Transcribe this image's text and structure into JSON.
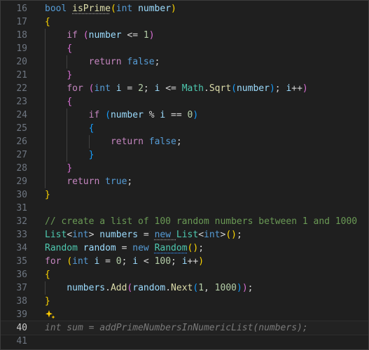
{
  "editor": {
    "theme": {
      "background": "#1f1f1f",
      "keyword": "#569cd6",
      "control": "#c586c0",
      "type": "#4ec9b0",
      "function": "#dcdcaa",
      "variable": "#9cdcfe",
      "number": "#b5cea8",
      "comment": "#6a9955",
      "sparkle": "#ffcc00"
    },
    "active_line": 40,
    "lines": [
      {
        "num": "16",
        "indent": 0,
        "tokens": [
          [
            "bool ",
            "keyword"
          ],
          [
            "isPrime",
            "func",
            "sq-dot"
          ],
          [
            "(",
            "b1"
          ],
          [
            "int ",
            "keyword"
          ],
          [
            "number",
            "var"
          ],
          [
            ")",
            "b1"
          ]
        ]
      },
      {
        "num": "17",
        "indent": 0,
        "tokens": [
          [
            "{",
            "b1"
          ]
        ]
      },
      {
        "num": "18",
        "indent": 1,
        "tokens": [
          [
            "if ",
            "control"
          ],
          [
            "(",
            "b2"
          ],
          [
            "number ",
            "var"
          ],
          [
            "<= ",
            "plain"
          ],
          [
            "1",
            "num"
          ],
          [
            ")",
            "b2"
          ]
        ]
      },
      {
        "num": "19",
        "indent": 1,
        "tokens": [
          [
            "{",
            "b2"
          ]
        ]
      },
      {
        "num": "20",
        "indent": 2,
        "tokens": [
          [
            "return ",
            "control"
          ],
          [
            "false",
            "keyword"
          ],
          [
            ";",
            "plain"
          ]
        ]
      },
      {
        "num": "21",
        "indent": 1,
        "tokens": [
          [
            "}",
            "b2"
          ]
        ]
      },
      {
        "num": "22",
        "indent": 1,
        "tokens": [
          [
            "for ",
            "control"
          ],
          [
            "(",
            "b2"
          ],
          [
            "int ",
            "keyword"
          ],
          [
            "i ",
            "var"
          ],
          [
            "= ",
            "plain"
          ],
          [
            "2",
            "num"
          ],
          [
            "; ",
            "plain"
          ],
          [
            "i ",
            "var"
          ],
          [
            "<= ",
            "plain"
          ],
          [
            "Math",
            "type"
          ],
          [
            ".",
            "plain"
          ],
          [
            "Sqrt",
            "func"
          ],
          [
            "(",
            "b3"
          ],
          [
            "number",
            "var"
          ],
          [
            ")",
            "b3"
          ],
          [
            "; ",
            "plain"
          ],
          [
            "i",
            "var"
          ],
          [
            "++",
            "plain"
          ],
          [
            ")",
            "b2"
          ]
        ]
      },
      {
        "num": "23",
        "indent": 1,
        "tokens": [
          [
            "{",
            "b2"
          ]
        ]
      },
      {
        "num": "24",
        "indent": 2,
        "tokens": [
          [
            "if ",
            "control"
          ],
          [
            "(",
            "b3"
          ],
          [
            "number ",
            "var"
          ],
          [
            "% ",
            "plain"
          ],
          [
            "i ",
            "var"
          ],
          [
            "== ",
            "plain"
          ],
          [
            "0",
            "num"
          ],
          [
            ")",
            "b3"
          ]
        ]
      },
      {
        "num": "25",
        "indent": 2,
        "tokens": [
          [
            "{",
            "b3"
          ]
        ]
      },
      {
        "num": "26",
        "indent": 3,
        "tokens": [
          [
            "return ",
            "control"
          ],
          [
            "false",
            "keyword"
          ],
          [
            ";",
            "plain"
          ]
        ]
      },
      {
        "num": "27",
        "indent": 2,
        "tokens": [
          [
            "}",
            "b3"
          ]
        ]
      },
      {
        "num": "28",
        "indent": 1,
        "tokens": [
          [
            "}",
            "b2"
          ]
        ]
      },
      {
        "num": "29",
        "indent": 1,
        "tokens": [
          [
            "return ",
            "control"
          ],
          [
            "true",
            "keyword"
          ],
          [
            ";",
            "plain"
          ]
        ]
      },
      {
        "num": "30",
        "indent": 0,
        "tokens": [
          [
            "}",
            "b1"
          ]
        ]
      },
      {
        "num": "31",
        "indent": 0,
        "tokens": []
      },
      {
        "num": "32",
        "indent": 0,
        "tokens": [
          [
            "// create a list of 100 random numbers between 1 and 1000",
            "comment"
          ]
        ]
      },
      {
        "num": "33",
        "indent": 0,
        "tokens": [
          [
            "List",
            "type"
          ],
          [
            "<",
            "plain"
          ],
          [
            "int",
            "keyword"
          ],
          [
            "> ",
            "plain"
          ],
          [
            "numbers ",
            "var"
          ],
          [
            "= ",
            "plain"
          ],
          [
            "new ",
            "keyword",
            "sq-dot"
          ],
          [
            "List",
            "type"
          ],
          [
            "<",
            "plain"
          ],
          [
            "int",
            "keyword"
          ],
          [
            ">",
            "plain"
          ],
          [
            "(",
            "b1"
          ],
          [
            ")",
            "b1"
          ],
          [
            ";",
            "plain"
          ]
        ]
      },
      {
        "num": "34",
        "indent": 0,
        "tokens": [
          [
            "Random ",
            "type"
          ],
          [
            "random ",
            "var"
          ],
          [
            "= ",
            "plain"
          ],
          [
            "new ",
            "keyword"
          ],
          [
            "Random",
            "type",
            "sq-info"
          ],
          [
            "(",
            "b1"
          ],
          [
            ")",
            "b1"
          ],
          [
            ";",
            "plain"
          ]
        ]
      },
      {
        "num": "35",
        "indent": 0,
        "tokens": [
          [
            "for ",
            "control"
          ],
          [
            "(",
            "b1"
          ],
          [
            "int ",
            "keyword"
          ],
          [
            "i ",
            "var"
          ],
          [
            "= ",
            "plain"
          ],
          [
            "0",
            "num"
          ],
          [
            "; ",
            "plain"
          ],
          [
            "i ",
            "var"
          ],
          [
            "< ",
            "plain"
          ],
          [
            "100",
            "num"
          ],
          [
            "; ",
            "plain"
          ],
          [
            "i",
            "var"
          ],
          [
            "++",
            "plain"
          ],
          [
            ")",
            "b1"
          ]
        ]
      },
      {
        "num": "36",
        "indent": 0,
        "tokens": [
          [
            "{",
            "b1"
          ]
        ]
      },
      {
        "num": "37",
        "indent": 1,
        "tokens": [
          [
            "numbers",
            "var"
          ],
          [
            ".",
            "plain"
          ],
          [
            "Add",
            "func"
          ],
          [
            "(",
            "b2"
          ],
          [
            "random",
            "var"
          ],
          [
            ".",
            "plain"
          ],
          [
            "Next",
            "func"
          ],
          [
            "(",
            "b3"
          ],
          [
            "1",
            "num"
          ],
          [
            ", ",
            "plain"
          ],
          [
            "1000",
            "num"
          ],
          [
            ")",
            "b3"
          ],
          [
            ")",
            "b2"
          ],
          [
            ";",
            "plain"
          ]
        ]
      },
      {
        "num": "38",
        "indent": 0,
        "tokens": [
          [
            "}",
            "b1"
          ]
        ]
      },
      {
        "num": "39",
        "indent": 0,
        "tokens": [],
        "sparkle": "sparkle-icon"
      },
      {
        "num": "40",
        "indent": 0,
        "tokens": [
          [
            "int sum = addPrimeNumbersInNumericList(numbers);",
            "ghost"
          ]
        ]
      },
      {
        "num": "41",
        "indent": 0,
        "tokens": []
      }
    ]
  }
}
